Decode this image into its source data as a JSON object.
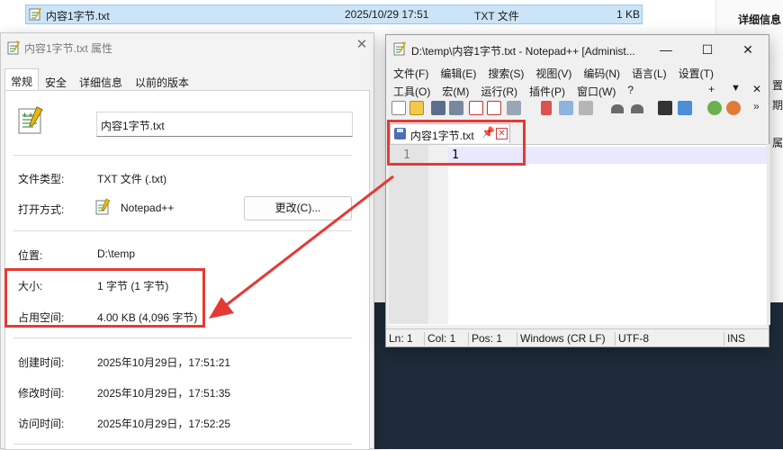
{
  "explorer": {
    "file_name": "内容1字节.txt",
    "modified": "2025/10/29 17:51",
    "type": "TXT 文件",
    "size": "1 KB",
    "right_panel_title": "详细信息",
    "right_panel_fragments": [
      "置",
      "期",
      "属"
    ]
  },
  "properties": {
    "title": "内容1字节.txt 属性",
    "tabs": [
      "常规",
      "安全",
      "详细信息",
      "以前的版本"
    ],
    "file_name": "内容1字节.txt",
    "file_type_label": "文件类型:",
    "file_type_value": "TXT 文件 (.txt)",
    "open_with_label": "打开方式:",
    "open_with_value": "Notepad++",
    "change_button": "更改(C)...",
    "location_label": "位置:",
    "location_value": "D:\\temp",
    "size_label": "大小:",
    "size_value": "1 字节 (1 字节)",
    "size_on_disk_label": "占用空间:",
    "size_on_disk_value": "4.00 KB (4,096 字节)",
    "created_label": "创建时间:",
    "created_value": "2025年10月29日，17:51:21",
    "modified_label": "修改时间:",
    "modified_value": "2025年10月29日，17:51:35",
    "accessed_label": "访问时间:",
    "accessed_value": "2025年10月29日，17:52:25"
  },
  "notepad": {
    "title": "D:\\temp\\内容1字节.txt - Notepad++ [Administ...",
    "menu_row1": [
      "文件(F)",
      "编辑(E)",
      "搜索(S)",
      "视图(V)",
      "编码(N)",
      "语言(L)",
      "设置(T)"
    ],
    "menu_row2": [
      "工具(O)",
      "宏(M)",
      "运行(R)",
      "插件(P)",
      "窗口(W)",
      "?"
    ],
    "menu_extra": [
      "+",
      "▼",
      "✕"
    ],
    "tab_name": "内容1字节.txt",
    "line_number": "1",
    "content": "1",
    "status": {
      "ln": "Ln: 1",
      "col": "Col: 1",
      "pos": "Pos: 1",
      "eol": "Windows (CR LF)",
      "encoding": "UTF-8",
      "mode": "INS"
    }
  },
  "colors": {
    "annotation_red": "#e53935",
    "selection_blue": "#cce4f7",
    "current_line": "#e8e8ff"
  }
}
